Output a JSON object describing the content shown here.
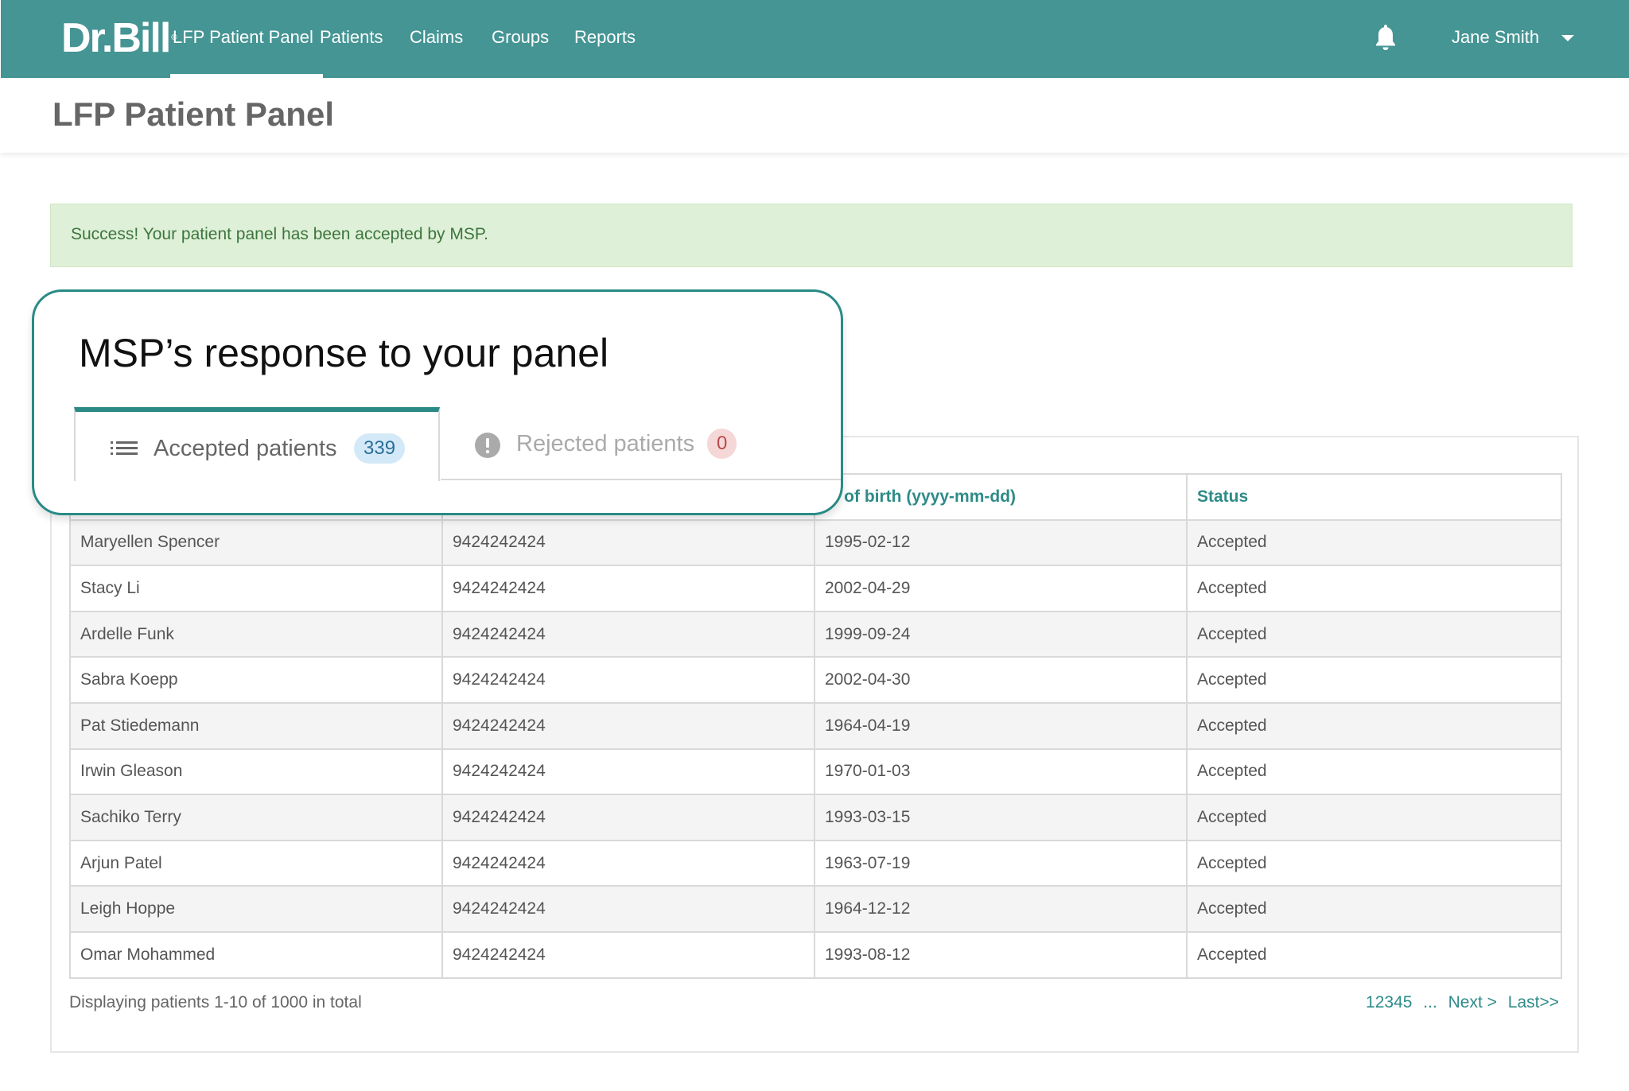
{
  "brand": {
    "logo_text": "Dr.Bill",
    "logo_mark": "®"
  },
  "nav": {
    "items": [
      {
        "label": "LFP Patient Panel",
        "active": true
      },
      {
        "label": "Patients",
        "active": false
      },
      {
        "label": "Claims",
        "active": false
      },
      {
        "label": "Groups",
        "active": false
      },
      {
        "label": "Reports",
        "active": false
      }
    ],
    "notification_icon": "bell-icon",
    "user_name": "Jane Smith",
    "user_menu_icon": "caret-down-icon"
  },
  "page": {
    "title": "LFP Patient Panel"
  },
  "alert": {
    "message": "Success! Your patient panel has been accepted by MSP."
  },
  "callout": {
    "title": "MSP’s response to your panel",
    "tabs": [
      {
        "label": "Accepted patients",
        "count": "339",
        "icon": "list-icon",
        "active": true
      },
      {
        "label": "Rejected patients",
        "count": "0",
        "icon": "exclamation-circle-icon",
        "active": false
      }
    ]
  },
  "table": {
    "columns": [
      "",
      "",
      "ate of birth (yyyy-mm-dd)",
      "Status"
    ],
    "rows": [
      [
        "Maryellen Spencer",
        "9424242424",
        "1995-02-12",
        "Accepted"
      ],
      [
        "Stacy Li",
        "9424242424",
        "2002-04-29",
        "Accepted"
      ],
      [
        "Ardelle Funk",
        "9424242424",
        "1999-09-24",
        "Accepted"
      ],
      [
        "Sabra Koepp",
        "9424242424",
        "2002-04-30",
        "Accepted"
      ],
      [
        "Pat Stiedemann",
        "9424242424",
        "1964-04-19",
        "Accepted"
      ],
      [
        "Irwin Gleason",
        "9424242424",
        "1970-01-03",
        "Accepted"
      ],
      [
        "Sachiko Terry",
        "9424242424",
        "1993-03-15",
        "Accepted"
      ],
      [
        "Arjun Patel",
        "9424242424",
        "1963-07-19",
        "Accepted"
      ],
      [
        "Leigh Hoppe",
        "9424242424",
        "1964-12-12",
        "Accepted"
      ],
      [
        "Omar Mohammed",
        "9424242424",
        "1993-08-12",
        "Accepted"
      ]
    ]
  },
  "footer": {
    "summary": "Displaying patients 1-10 of 1000 in total",
    "pager": {
      "pages": "12345",
      "ellipsis": "...",
      "next": "Next >",
      "last": "Last>>"
    }
  },
  "colors": {
    "teal": "#459594",
    "accent": "#2a8a86",
    "success_bg": "#dff0d8",
    "success_text": "#3c763d"
  }
}
